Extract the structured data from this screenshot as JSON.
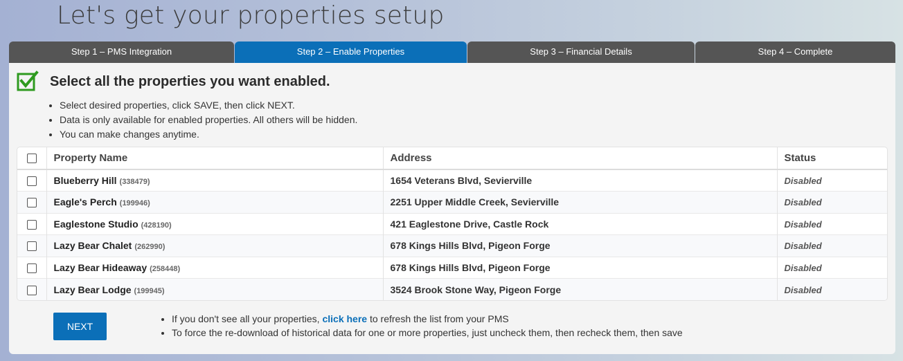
{
  "page": {
    "title": "Let's get your properties setup"
  },
  "steps": [
    {
      "label": "Step 1 – PMS Integration",
      "active": false
    },
    {
      "label": "Step 2 – Enable Properties",
      "active": true
    },
    {
      "label": "Step 3 – Financial Details",
      "active": false
    },
    {
      "label": "Step 4 – Complete",
      "active": false
    }
  ],
  "panel": {
    "icon": "checked-box-icon",
    "heading": "Select all the properties you want enabled.",
    "instructions": [
      "Select desired properties, click SAVE, then click NEXT.",
      "Data is only available for enabled properties. All others will be hidden.",
      "You can make changes anytime."
    ]
  },
  "table": {
    "headers": {
      "name": "Property Name",
      "address": "Address",
      "status": "Status"
    },
    "rows": [
      {
        "name": "Blueberry Hill",
        "id": "(338479)",
        "address": "1654 Veterans Blvd, Sevierville",
        "status": "Disabled"
      },
      {
        "name": "Eagle's Perch",
        "id": "(199946)",
        "address": "2251 Upper Middle Creek, Sevierville",
        "status": "Disabled"
      },
      {
        "name": "Eaglestone Studio",
        "id": "(428190)",
        "address": "421 Eaglestone Drive, Castle Rock",
        "status": "Disabled"
      },
      {
        "name": "Lazy Bear Chalet",
        "id": "(262990)",
        "address": "678 Kings Hills Blvd, Pigeon Forge",
        "status": "Disabled"
      },
      {
        "name": "Lazy Bear Hideaway",
        "id": "(258448)",
        "address": "678 Kings Hills Blvd, Pigeon Forge",
        "status": "Disabled"
      },
      {
        "name": "Lazy Bear Lodge",
        "id": "(199945)",
        "address": "3524 Brook Stone Way, Pigeon Forge",
        "status": "Disabled"
      }
    ]
  },
  "footer": {
    "next_label": "NEXT",
    "notes": {
      "refresh_prefix": "If you don't see all your properties, ",
      "refresh_link": "click here",
      "refresh_suffix": " to refresh the list from your PMS",
      "redownload": "To force the re-download of historical data for one or more properties, just uncheck them, then recheck them, then save"
    }
  },
  "colors": {
    "accent": "#0b6fb8",
    "step_inactive": "#555555",
    "check_green": "#2e9a1f"
  }
}
